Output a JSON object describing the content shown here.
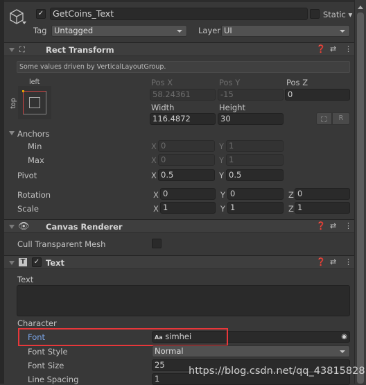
{
  "header": {
    "active": true,
    "name": "GetCoins_Text",
    "static_label": "Static",
    "tag_label": "Tag",
    "tag_value": "Untagged",
    "layer_label": "Layer",
    "layer_value": "UI"
  },
  "rect_transform": {
    "title": "Rect Transform",
    "info": "Some values driven by VerticalLayoutGroup.",
    "anchor_h": "left",
    "anchor_v": "top",
    "pos_x_label": "Pos X",
    "pos_x": "58.24361",
    "pos_y_label": "Pos Y",
    "pos_y": "-15",
    "pos_z_label": "Pos Z",
    "pos_z": "0",
    "width_label": "Width",
    "width": "116.4872",
    "height_label": "Height",
    "height": "30",
    "raw_button": "R",
    "anchors_label": "Anchors",
    "min_label": "Min",
    "min_x": "0",
    "min_y": "1",
    "max_label": "Max",
    "max_x": "0",
    "max_y": "1",
    "pivot_label": "Pivot",
    "pivot_x": "0.5",
    "pivot_y": "0.5",
    "rotation_label": "Rotation",
    "rot_x": "0",
    "rot_y": "0",
    "rot_z": "0",
    "scale_label": "Scale",
    "scale_x": "1",
    "scale_y": "1",
    "scale_z": "1",
    "axis_x": "X",
    "axis_y": "Y",
    "axis_z": "Z"
  },
  "canvas_renderer": {
    "title": "Canvas Renderer",
    "cull_label": "Cull Transparent Mesh",
    "cull": false
  },
  "text_component": {
    "title": "Text",
    "enabled": true,
    "text_label": "Text",
    "text_value": "",
    "character_label": "Character",
    "font_label": "Font",
    "font_icon": "Aa",
    "font_value": "simhei",
    "font_style_label": "Font Style",
    "font_style": "Normal",
    "font_size_label": "Font Size",
    "font_size": "25",
    "line_spacing_label": "Line Spacing",
    "line_spacing": "1"
  },
  "watermark": "https://blog.csdn.net/qq_43815828",
  "colors": {
    "highlight_box": "#e8373a",
    "font_label": "#7ba6ea"
  }
}
